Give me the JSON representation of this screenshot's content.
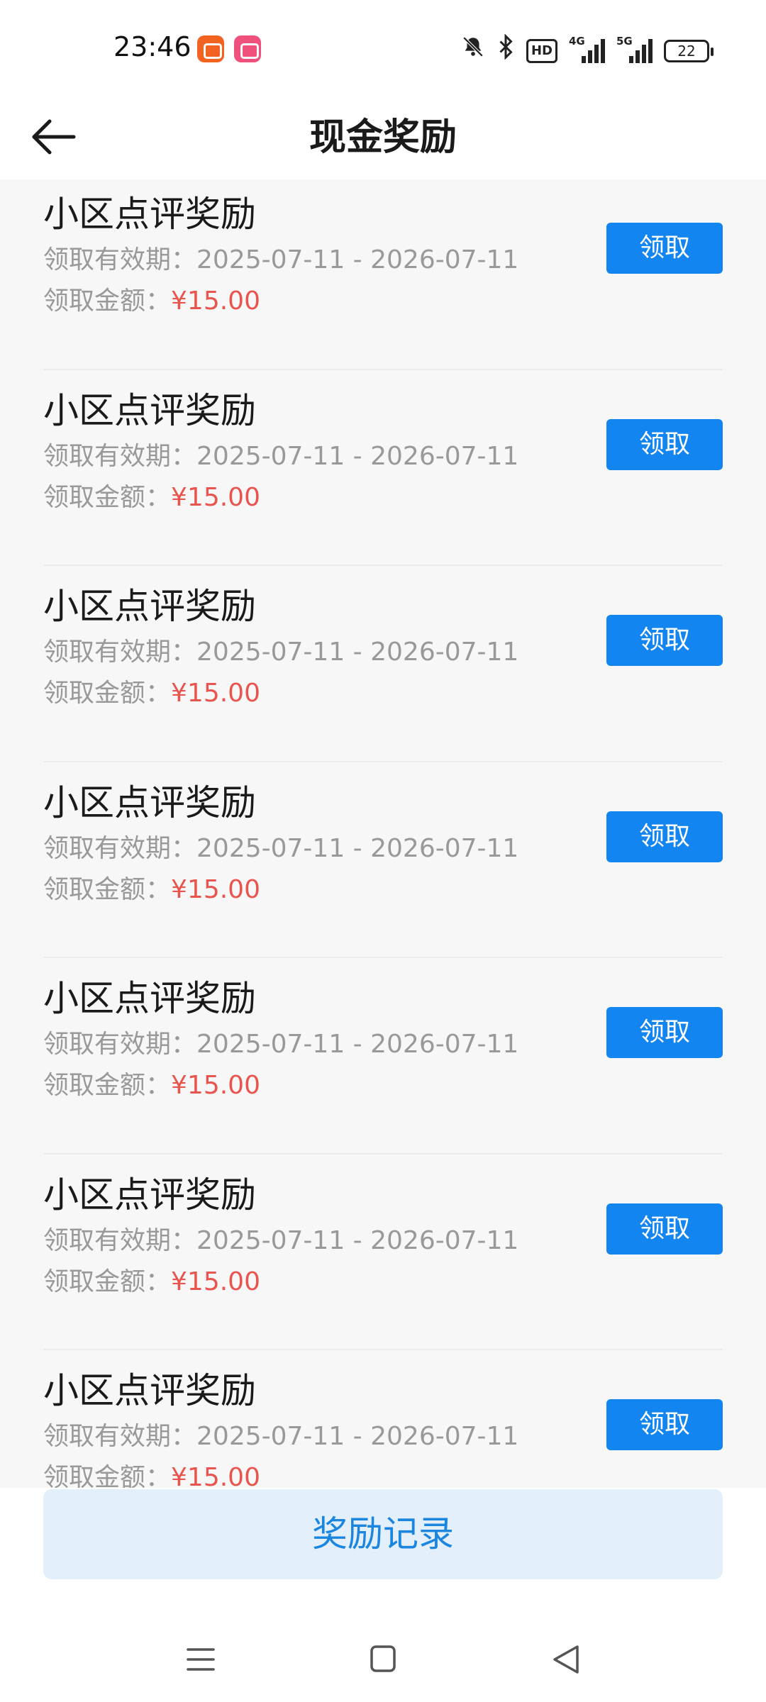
{
  "status_bar": {
    "time": "23:46",
    "icons": [
      "app-icon-orange",
      "app-icon-pink",
      "mute-bell-icon",
      "bluetooth-icon",
      "hd-icon",
      "4g-signal-icon",
      "5g-signal-icon",
      "battery-icon"
    ],
    "hd_label": "HD",
    "net_4g": "4G",
    "net_5g": "5G",
    "battery": "22"
  },
  "header": {
    "title": "现金奖励",
    "back_icon": "arrow-left-icon"
  },
  "rewards": [
    {
      "title": "小区点评奖励",
      "period_label": "领取有效期：",
      "period": "2025-07-11 - 2026-07-11",
      "amount_label": "领取金额：",
      "amount": "¥15.00",
      "button": "领取"
    },
    {
      "title": "小区点评奖励",
      "period_label": "领取有效期：",
      "period": "2025-07-11 - 2026-07-11",
      "amount_label": "领取金额：",
      "amount": "¥15.00",
      "button": "领取"
    },
    {
      "title": "小区点评奖励",
      "period_label": "领取有效期：",
      "period": "2025-07-11 - 2026-07-11",
      "amount_label": "领取金额：",
      "amount": "¥15.00",
      "button": "领取"
    },
    {
      "title": "小区点评奖励",
      "period_label": "领取有效期：",
      "period": "2025-07-11 - 2026-07-11",
      "amount_label": "领取金额：",
      "amount": "¥15.00",
      "button": "领取"
    },
    {
      "title": "小区点评奖励",
      "period_label": "领取有效期：",
      "period": "2025-07-11 - 2026-07-11",
      "amount_label": "领取金额：",
      "amount": "¥15.00",
      "button": "领取"
    },
    {
      "title": "小区点评奖励",
      "period_label": "领取有效期：",
      "period": "2025-07-11 - 2026-07-11",
      "amount_label": "领取金额：",
      "amount": "¥15.00",
      "button": "领取"
    },
    {
      "title": "小区点评奖励",
      "period_label": "领取有效期：",
      "period": "2025-07-11 - 2026-07-11",
      "amount_label": "领取金额：",
      "amount": "¥15.00",
      "button": "领取"
    }
  ],
  "bottom": {
    "record_button": "奖励记录"
  },
  "nav": {
    "icons": [
      "menu-icon",
      "home-square-icon",
      "back-triangle-icon"
    ]
  },
  "colors": {
    "accent_blue": "#1385f0",
    "amount_red": "#e8554e",
    "record_bg": "#e3effa",
    "record_text": "#1a86e0"
  }
}
